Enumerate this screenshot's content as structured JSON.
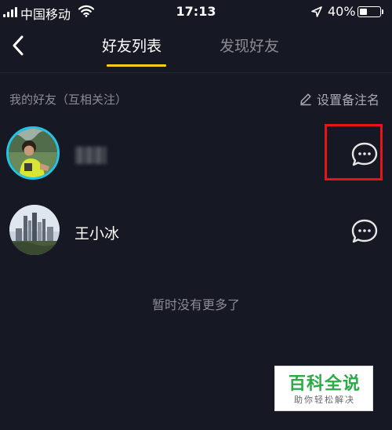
{
  "status_bar": {
    "carrier": "中国移动",
    "time": "17:13",
    "battery": "40%",
    "battery_level": 0.4
  },
  "nav": {
    "tabs": [
      {
        "label": "好友列表",
        "active": true
      },
      {
        "label": "发现好友",
        "active": false
      }
    ],
    "back_icon": "chevron-left-icon"
  },
  "section": {
    "title": "我的好友（互相关注）",
    "set_remark_label": "设置备注名",
    "set_remark_icon": "pencil-icon"
  },
  "friends": [
    {
      "name": "",
      "name_obscured": true,
      "avatar": "photo-child",
      "chat_icon": "chat-bubble-icon"
    },
    {
      "name": "王小冰",
      "name_obscured": false,
      "avatar": "photo-city",
      "chat_icon": "chat-bubble-icon"
    }
  ],
  "empty_hint": "暂时没有更多了",
  "watermark": {
    "title": "百科全说",
    "subtitle": "助你轻松解决"
  },
  "colors": {
    "background": "#161823",
    "accent": "#face15",
    "avatar_ring": "#22c4e8",
    "highlight": "#e8141c",
    "watermark_green": "#2aab46"
  }
}
